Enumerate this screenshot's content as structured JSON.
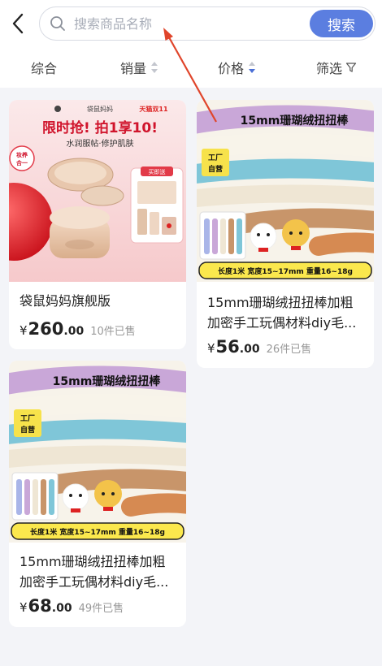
{
  "header": {
    "search_placeholder": "搜索商品名称",
    "search_button": "搜索"
  },
  "sort_bar": {
    "items": [
      {
        "label": "综合"
      },
      {
        "label": "销量"
      },
      {
        "label": "价格"
      },
      {
        "label": "筛选"
      }
    ]
  },
  "products": [
    {
      "title": "袋鼠妈妈旗舰版",
      "price_symbol": "¥",
      "price_int": "260",
      "price_dec": ".00",
      "sold": "10件已售",
      "image": {
        "brand_line": "袋鼠妈妈",
        "event": "天猫双11",
        "headline": "限时抢! 拍1享10!",
        "subline": "水润服帖·修护肌肤",
        "sticker": "妆养合一",
        "gift_label": "买即送"
      }
    },
    {
      "title": "15mm珊瑚绒扭扭棒加粗加密手工玩偶材料diy毛...",
      "price_symbol": "¥",
      "price_int": "56",
      "price_dec": ".00",
      "sold": "26件已售",
      "image": {
        "headline": "15mm珊瑚绒扭扭棒",
        "factory_badge": "工厂自营",
        "spec_bar": "长度1米  宽度15~17mm  重量16~18g"
      }
    },
    {
      "title": "15mm珊瑚绒扭扭棒加粗加密手工玩偶材料diy毛...",
      "price_symbol": "¥",
      "price_int": "68",
      "price_dec": ".00",
      "sold": "49件已售",
      "image": {
        "headline": "15mm珊瑚绒扭扭棒",
        "factory_badge": "工厂自营",
        "spec_bar": "长度1米  宽度15~17mm  重量16~18g"
      }
    }
  ],
  "colors": {
    "accent": "#5b7ee0",
    "annotation_arrow": "#e0452b"
  }
}
